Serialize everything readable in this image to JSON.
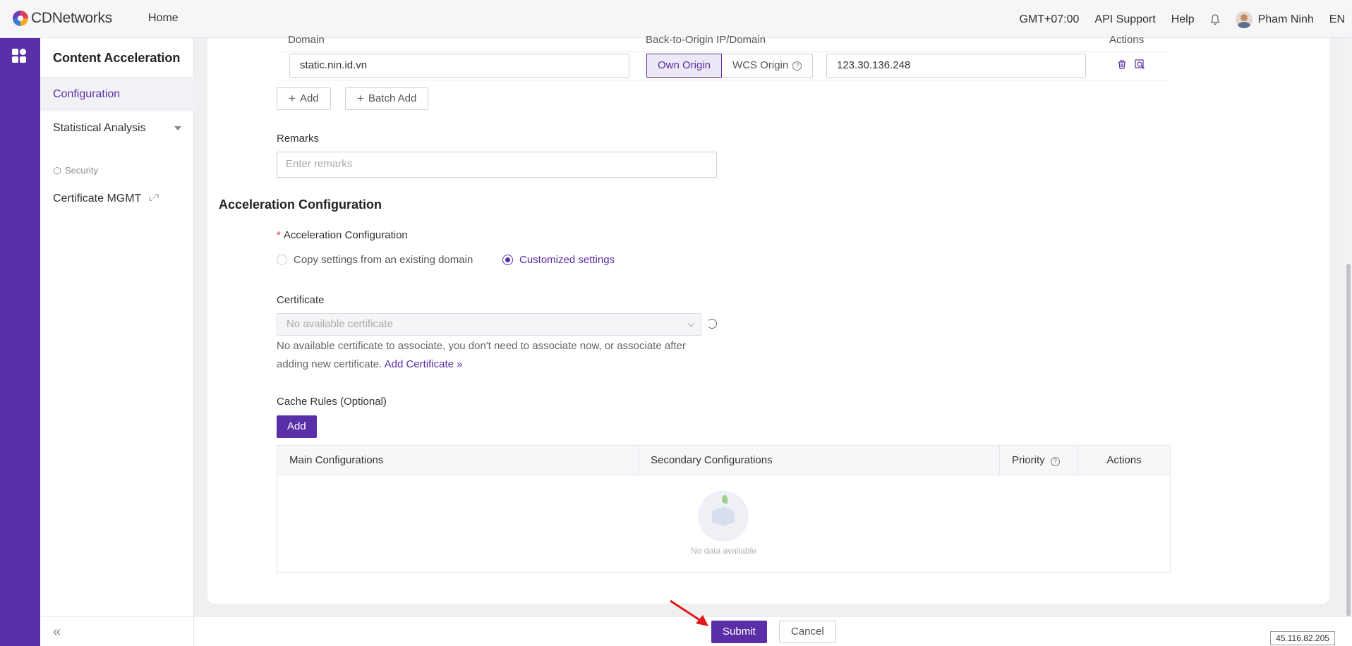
{
  "topbar": {
    "logo": "CDNetworks",
    "home": "Home",
    "timezone": "GMT+07:00",
    "api_support": "API Support",
    "help": "Help",
    "user_name": "Pham Ninh",
    "language": "EN"
  },
  "sidebar": {
    "title": "Content Acceleration",
    "items": [
      {
        "label": "Configuration",
        "active": true
      },
      {
        "label": "Statistical Analysis",
        "expandable": true
      }
    ],
    "section": "Security",
    "section_items": [
      {
        "label": "Certificate MGMT"
      }
    ]
  },
  "origin_table": {
    "headers": [
      "Domain",
      "Back-to-Origin IP/Domain",
      "Actions"
    ],
    "row": {
      "domain": "static.nin.id.vn",
      "origin_type_options": [
        "Own Origin",
        "WCS Origin"
      ],
      "origin_type_selected": "Own Origin",
      "origin_value": "123.30.136.248"
    },
    "add_label": "Add",
    "batch_add_label": "Batch Add"
  },
  "remarks": {
    "label": "Remarks",
    "placeholder": "Enter remarks"
  },
  "acceleration": {
    "heading": "Acceleration Configuration",
    "field_label": "Acceleration Configuration",
    "options": [
      "Copy settings from an existing domain",
      "Customized settings"
    ],
    "selected": "Customized settings"
  },
  "certificate": {
    "label": "Certificate",
    "placeholder": "No available certificate",
    "hint": "No available certificate to associate, you don't need to associate now, or associate after adding new certificate.",
    "add_link": "Add Certificate »"
  },
  "cache_rules": {
    "label": "Cache Rules (Optional)",
    "add_label": "Add",
    "columns": [
      "Main Configurations",
      "Secondary Configurations",
      "Priority",
      "Actions"
    ],
    "empty_text": "No data available"
  },
  "footer": {
    "submit": "Submit",
    "cancel": "Cancel"
  },
  "ip_badge": "45.116.82.205",
  "colors": {
    "brand": "#5a2ea6"
  }
}
